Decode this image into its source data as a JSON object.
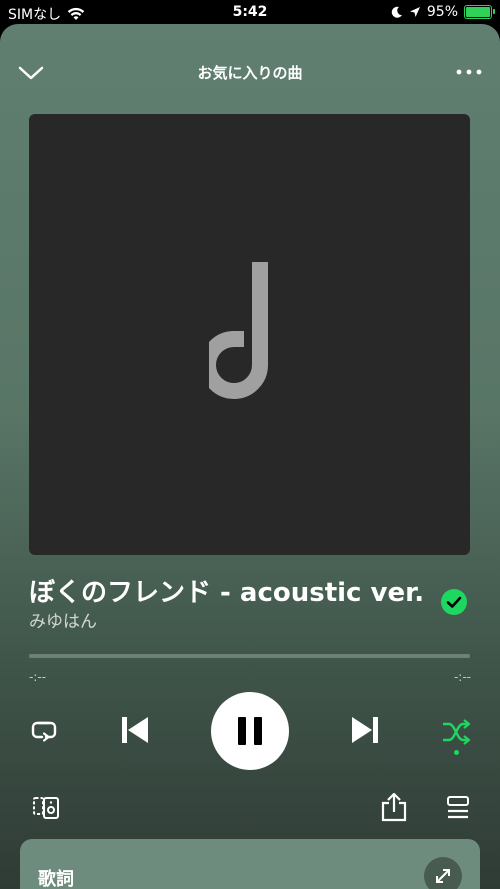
{
  "status_bar": {
    "carrier": "SIMなし",
    "time": "5:42",
    "battery_percent": "95%"
  },
  "header": {
    "playlist_title": "お気に入りの曲"
  },
  "track": {
    "title": "ぼくのフレンド - acoustic ver.",
    "artist": "みゆはん",
    "liked": true
  },
  "playback": {
    "elapsed": "-:--",
    "remaining": "-:--",
    "progress": 0
  },
  "lyrics": {
    "label": "歌詞"
  },
  "colors": {
    "accent_green": "#1ed760"
  },
  "icons": {
    "close": "chevron-down-icon",
    "more": "more-icon",
    "liked": "check-circle-icon",
    "repeat": "repeat-icon",
    "previous": "skip-previous-icon",
    "pause": "pause-icon",
    "next": "skip-next-icon",
    "shuffle": "shuffle-icon",
    "device": "connect-device-icon",
    "share": "share-icon",
    "queue": "queue-icon",
    "expand": "expand-icon"
  }
}
